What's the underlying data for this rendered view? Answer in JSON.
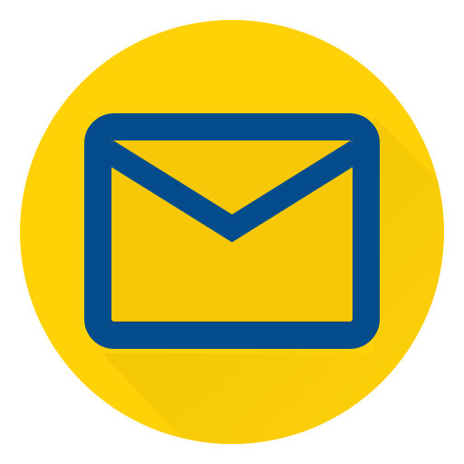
{
  "icon": {
    "name": "mail-envelope-icon",
    "background_color": "#FFD208",
    "circle_color": "#FFD208",
    "envelope_stroke_color": "#044C8C",
    "envelope_fill_color": "#F7C808",
    "long_shadow_color": "#E6BA00",
    "long_shadow": true
  }
}
